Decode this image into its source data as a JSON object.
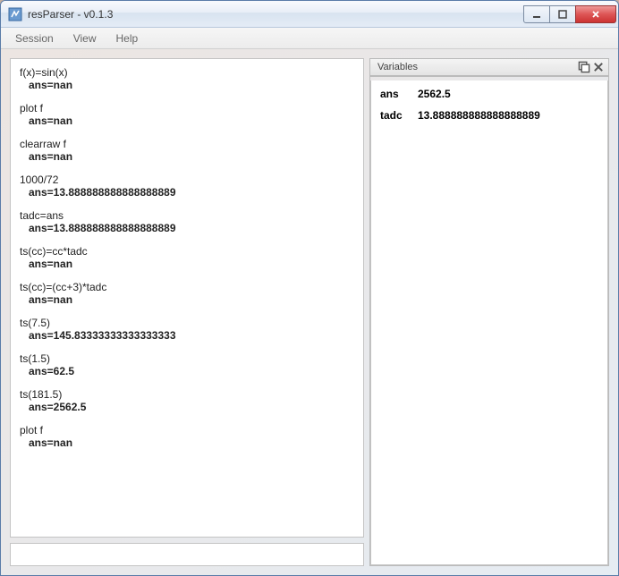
{
  "window": {
    "title": "resParser - v0.1.3"
  },
  "menu": {
    "session": "Session",
    "view": "View",
    "help": "Help"
  },
  "console": {
    "entries": [
      {
        "input": "f(x)=sin(x)",
        "output": "ans=nan"
      },
      {
        "input": "plot f",
        "output": "ans=nan"
      },
      {
        "input": "clearraw f",
        "output": "ans=nan"
      },
      {
        "input": "1000/72",
        "output": "ans=13.888888888888888889"
      },
      {
        "input": "tadc=ans",
        "output": "ans=13.888888888888888889"
      },
      {
        "input": "ts(cc)=cc*tadc",
        "output": "ans=nan"
      },
      {
        "input": "ts(cc)=(cc+3)*tadc",
        "output": "ans=nan"
      },
      {
        "input": "ts(7.5)",
        "output": "ans=145.83333333333333333"
      },
      {
        "input": "ts(1.5)",
        "output": "ans=62.5"
      },
      {
        "input": "ts(181.5)",
        "output": "ans=2562.5"
      },
      {
        "input": "plot f",
        "output": "ans=nan"
      }
    ]
  },
  "variables": {
    "title": "Variables",
    "rows": [
      {
        "name": "ans",
        "value": "2562.5"
      },
      {
        "name": "tadc",
        "value": "13.888888888888888889"
      }
    ]
  }
}
